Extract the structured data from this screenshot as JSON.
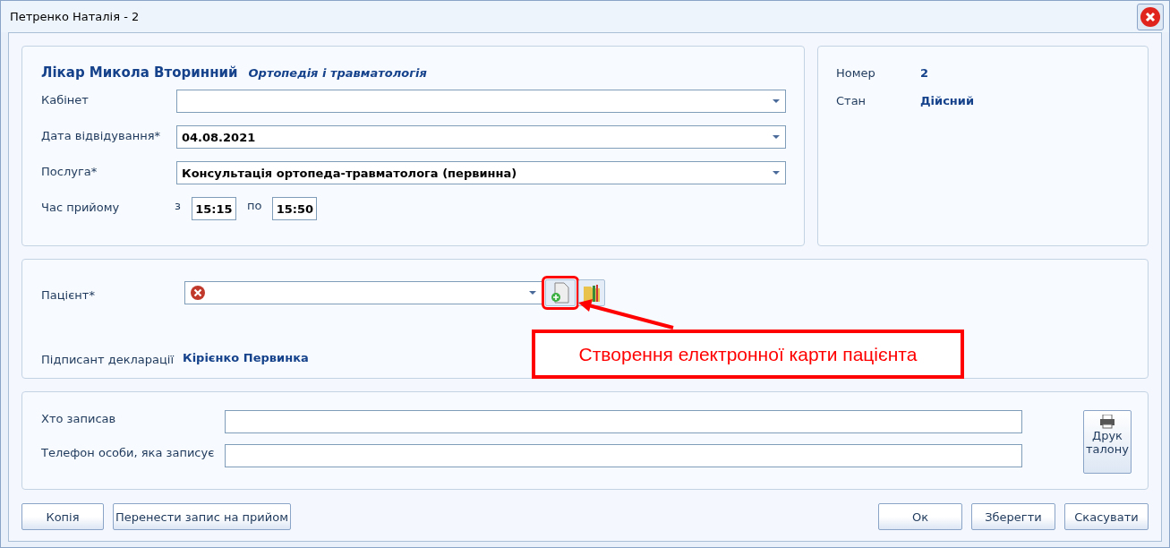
{
  "window": {
    "title": "Петренко Наталія - 2"
  },
  "doctor": {
    "name": "Лікар Микола Вторинний",
    "specialty": "Ортопедія і травматологія"
  },
  "fields": [
    {
      "label": "Кабінет"
    },
    {
      "label": "Дата відвідування*",
      "value": "04.08.2021"
    },
    {
      "label": "Послуга*",
      "value": "Консультація ортопеда-травматолога (первинна)"
    }
  ],
  "time": {
    "label": "Час прийому",
    "from_label": "з",
    "from": "15:15",
    "to_label": "по",
    "to": "15:50"
  },
  "info": [
    {
      "label": "Номер",
      "value": "2"
    },
    {
      "label": "Стан",
      "value": "Дійсний"
    }
  ],
  "patient": {
    "label": "Пацієнт*",
    "error": true
  },
  "signatory": {
    "label": "Підписант декларації",
    "value": "Кірієнко Первинка"
  },
  "callout": {
    "text": "Створення електронної карти пацієнта"
  },
  "recorder": [
    {
      "label": "Хто записав"
    },
    {
      "label": "Телефон особи, яка записує"
    }
  ],
  "print_button": {
    "label": "Друк талону"
  },
  "left_buttons": [
    "Копія",
    "Перенести запис на прийом"
  ],
  "right_buttons": [
    "Ок",
    "Зберегти",
    "Скасувати"
  ]
}
